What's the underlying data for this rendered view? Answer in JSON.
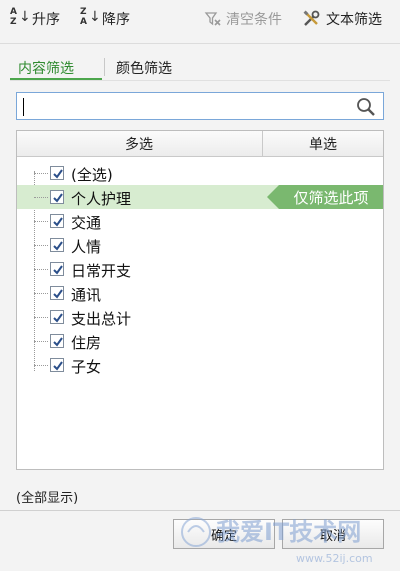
{
  "toolbar": {
    "sort_asc": "升序",
    "sort_desc": "降序",
    "clear": "清空条件",
    "text_filter": "文本筛选",
    "sort_asc_icon_letters_top": "A",
    "sort_asc_icon_letters_bottom": "Z",
    "sort_desc_icon_letters_top": "Z",
    "sort_desc_icon_letters_bottom": "A"
  },
  "tabs": [
    {
      "label": "内容筛选",
      "active": true
    },
    {
      "label": "颜色筛选",
      "active": false
    }
  ],
  "search": {
    "value": "",
    "placeholder": ""
  },
  "list": {
    "header_multi": "多选",
    "header_single": "单选",
    "items": [
      {
        "label": "(全选)",
        "checked": true
      },
      {
        "label": "个人护理",
        "checked": true,
        "selected": true
      },
      {
        "label": "交通",
        "checked": true
      },
      {
        "label": "人情",
        "checked": true
      },
      {
        "label": "日常开支",
        "checked": true
      },
      {
        "label": "通讯",
        "checked": true
      },
      {
        "label": "支出总计",
        "checked": true
      },
      {
        "label": "住房",
        "checked": true
      },
      {
        "label": "子女",
        "checked": true
      }
    ],
    "only_this_label": "仅筛选此项"
  },
  "status": {
    "show_all": "(全部显示)"
  },
  "buttons": {
    "ok": "确定",
    "cancel": "取消"
  },
  "watermark": {
    "text": "我爱IT技术网",
    "url": "www.52ij.com"
  },
  "colors": {
    "accent_green": "#7ab86f",
    "selected_row": "#d7ecd0",
    "active_tab": "#2f8a2f",
    "search_border": "#7aa7d9"
  },
  "icons": {
    "sort_asc": "sort-ascending-icon",
    "sort_desc": "sort-descending-icon",
    "clear": "funnel-clear-icon",
    "text_filter": "tools-icon",
    "search": "magnifier-icon"
  }
}
